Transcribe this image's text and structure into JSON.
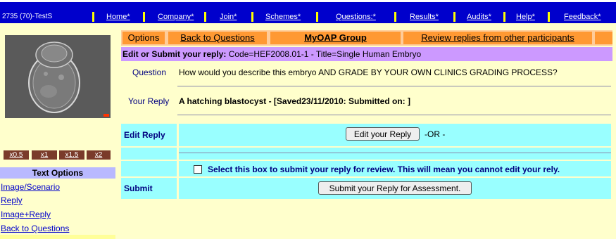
{
  "topbar": {
    "user": "2735 (70)-TestS",
    "nav": [
      "Home*",
      "Company*",
      "Join*",
      "Schemes*",
      "Questions:*",
      "Results*",
      "Audits*",
      "Help*",
      "Feedback*"
    ]
  },
  "sidebar": {
    "zoom": [
      "x0.5",
      "x1",
      "x1.5",
      "x2"
    ],
    "text_options_title": "Text Options",
    "links": [
      "Image/Scenario",
      "Reply",
      "Image+Reply",
      "Back to Questions"
    ]
  },
  "options_bar": {
    "options": "Options",
    "back": "Back to Questions",
    "group": "MyOAP Group",
    "review": "Review replies from other participants"
  },
  "edit_header": {
    "bold": "Edit or Submit your reply:",
    "rest": "Code=HEF2008.01-1 - Title=Single Human Embryo"
  },
  "question": {
    "label": "Question",
    "text": "How would you describe this embryo AND GRADE BY YOUR OWN CLINICS GRADING PROCESS?"
  },
  "reply": {
    "label": "Your Reply",
    "text": "A hatching blastocyst - [Saved23/11/2010: Submitted on: ]"
  },
  "edit_reply": {
    "label": "Edit Reply",
    "button": "Edit your Reply",
    "or": "-OR -"
  },
  "submit": {
    "checkbox_label": "Select this box to submit your reply for review. This will mean you cannot edit your rely.",
    "label": "Submit",
    "button": "Submit your Reply for Assessment."
  }
}
